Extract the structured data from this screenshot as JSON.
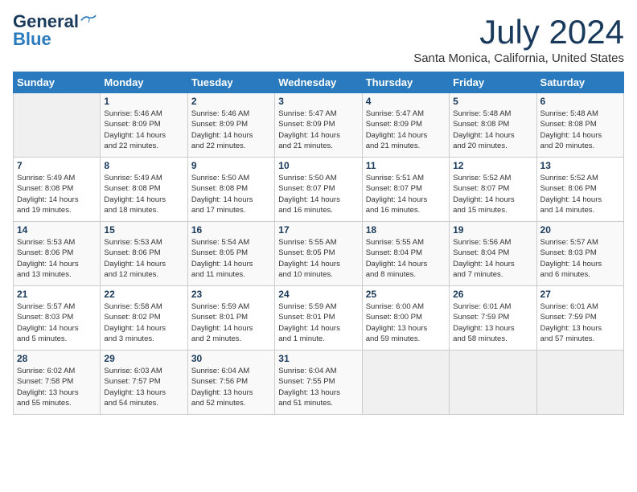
{
  "logo": {
    "line1": "General",
    "line2": "Blue"
  },
  "title": "July 2024",
  "subtitle": "Santa Monica, California, United States",
  "weekdays": [
    "Sunday",
    "Monday",
    "Tuesday",
    "Wednesday",
    "Thursday",
    "Friday",
    "Saturday"
  ],
  "weeks": [
    [
      {
        "day": "",
        "info": ""
      },
      {
        "day": "1",
        "info": "Sunrise: 5:46 AM\nSunset: 8:09 PM\nDaylight: 14 hours\nand 22 minutes."
      },
      {
        "day": "2",
        "info": "Sunrise: 5:46 AM\nSunset: 8:09 PM\nDaylight: 14 hours\nand 22 minutes."
      },
      {
        "day": "3",
        "info": "Sunrise: 5:47 AM\nSunset: 8:09 PM\nDaylight: 14 hours\nand 21 minutes."
      },
      {
        "day": "4",
        "info": "Sunrise: 5:47 AM\nSunset: 8:09 PM\nDaylight: 14 hours\nand 21 minutes."
      },
      {
        "day": "5",
        "info": "Sunrise: 5:48 AM\nSunset: 8:08 PM\nDaylight: 14 hours\nand 20 minutes."
      },
      {
        "day": "6",
        "info": "Sunrise: 5:48 AM\nSunset: 8:08 PM\nDaylight: 14 hours\nand 20 minutes."
      }
    ],
    [
      {
        "day": "7",
        "info": "Sunrise: 5:49 AM\nSunset: 8:08 PM\nDaylight: 14 hours\nand 19 minutes."
      },
      {
        "day": "8",
        "info": "Sunrise: 5:49 AM\nSunset: 8:08 PM\nDaylight: 14 hours\nand 18 minutes."
      },
      {
        "day": "9",
        "info": "Sunrise: 5:50 AM\nSunset: 8:08 PM\nDaylight: 14 hours\nand 17 minutes."
      },
      {
        "day": "10",
        "info": "Sunrise: 5:50 AM\nSunset: 8:07 PM\nDaylight: 14 hours\nand 16 minutes."
      },
      {
        "day": "11",
        "info": "Sunrise: 5:51 AM\nSunset: 8:07 PM\nDaylight: 14 hours\nand 16 minutes."
      },
      {
        "day": "12",
        "info": "Sunrise: 5:52 AM\nSunset: 8:07 PM\nDaylight: 14 hours\nand 15 minutes."
      },
      {
        "day": "13",
        "info": "Sunrise: 5:52 AM\nSunset: 8:06 PM\nDaylight: 14 hours\nand 14 minutes."
      }
    ],
    [
      {
        "day": "14",
        "info": "Sunrise: 5:53 AM\nSunset: 8:06 PM\nDaylight: 14 hours\nand 13 minutes."
      },
      {
        "day": "15",
        "info": "Sunrise: 5:53 AM\nSunset: 8:06 PM\nDaylight: 14 hours\nand 12 minutes."
      },
      {
        "day": "16",
        "info": "Sunrise: 5:54 AM\nSunset: 8:05 PM\nDaylight: 14 hours\nand 11 minutes."
      },
      {
        "day": "17",
        "info": "Sunrise: 5:55 AM\nSunset: 8:05 PM\nDaylight: 14 hours\nand 10 minutes."
      },
      {
        "day": "18",
        "info": "Sunrise: 5:55 AM\nSunset: 8:04 PM\nDaylight: 14 hours\nand 8 minutes."
      },
      {
        "day": "19",
        "info": "Sunrise: 5:56 AM\nSunset: 8:04 PM\nDaylight: 14 hours\nand 7 minutes."
      },
      {
        "day": "20",
        "info": "Sunrise: 5:57 AM\nSunset: 8:03 PM\nDaylight: 14 hours\nand 6 minutes."
      }
    ],
    [
      {
        "day": "21",
        "info": "Sunrise: 5:57 AM\nSunset: 8:03 PM\nDaylight: 14 hours\nand 5 minutes."
      },
      {
        "day": "22",
        "info": "Sunrise: 5:58 AM\nSunset: 8:02 PM\nDaylight: 14 hours\nand 3 minutes."
      },
      {
        "day": "23",
        "info": "Sunrise: 5:59 AM\nSunset: 8:01 PM\nDaylight: 14 hours\nand 2 minutes."
      },
      {
        "day": "24",
        "info": "Sunrise: 5:59 AM\nSunset: 8:01 PM\nDaylight: 14 hours\nand 1 minute."
      },
      {
        "day": "25",
        "info": "Sunrise: 6:00 AM\nSunset: 8:00 PM\nDaylight: 13 hours\nand 59 minutes."
      },
      {
        "day": "26",
        "info": "Sunrise: 6:01 AM\nSunset: 7:59 PM\nDaylight: 13 hours\nand 58 minutes."
      },
      {
        "day": "27",
        "info": "Sunrise: 6:01 AM\nSunset: 7:59 PM\nDaylight: 13 hours\nand 57 minutes."
      }
    ],
    [
      {
        "day": "28",
        "info": "Sunrise: 6:02 AM\nSunset: 7:58 PM\nDaylight: 13 hours\nand 55 minutes."
      },
      {
        "day": "29",
        "info": "Sunrise: 6:03 AM\nSunset: 7:57 PM\nDaylight: 13 hours\nand 54 minutes."
      },
      {
        "day": "30",
        "info": "Sunrise: 6:04 AM\nSunset: 7:56 PM\nDaylight: 13 hours\nand 52 minutes."
      },
      {
        "day": "31",
        "info": "Sunrise: 6:04 AM\nSunset: 7:55 PM\nDaylight: 13 hours\nand 51 minutes."
      },
      {
        "day": "",
        "info": ""
      },
      {
        "day": "",
        "info": ""
      },
      {
        "day": "",
        "info": ""
      }
    ]
  ]
}
